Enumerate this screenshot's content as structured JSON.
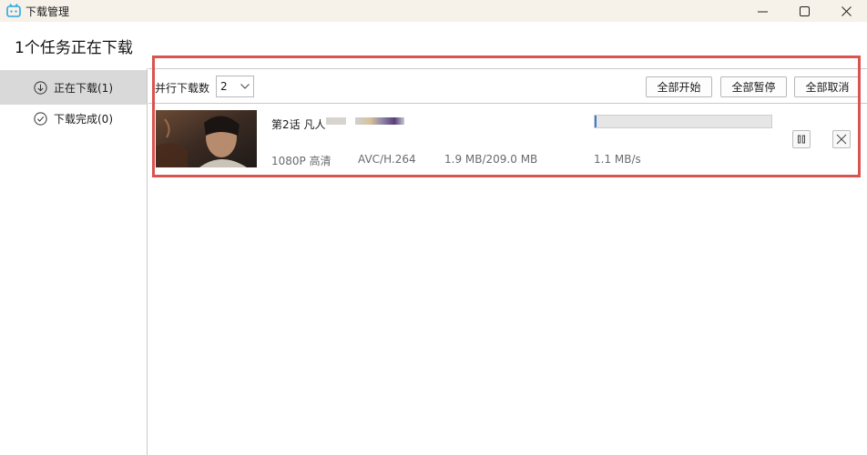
{
  "window": {
    "title": "下载管理",
    "controls": [
      "minimize-icon",
      "maximize-icon",
      "close-icon"
    ]
  },
  "heading": "1个任务正在下载",
  "sidebar": {
    "items": [
      {
        "label": "正在下载(1)",
        "icon": "download-circle-icon",
        "active": true
      },
      {
        "label": "下载完成(0)",
        "icon": "check-circle-icon",
        "active": false
      }
    ]
  },
  "toolbar": {
    "parallel_label": "并行下载数",
    "parallel_value": "2",
    "start_all": "全部开始",
    "pause_all": "全部暂停",
    "cancel_all": "全部取消"
  },
  "downloads": [
    {
      "title": "第2话 凡人",
      "resolution": "1080P 高清",
      "codec": "AVC/H.264",
      "size": "1.9 MB/209.0 MB",
      "speed": "1.1 MB/s",
      "progress": 0.009
    }
  ],
  "colors": {
    "titlebar": "#f6f1e9",
    "highlight_border": "#d9534f",
    "active_item": "#d9d9d9"
  }
}
